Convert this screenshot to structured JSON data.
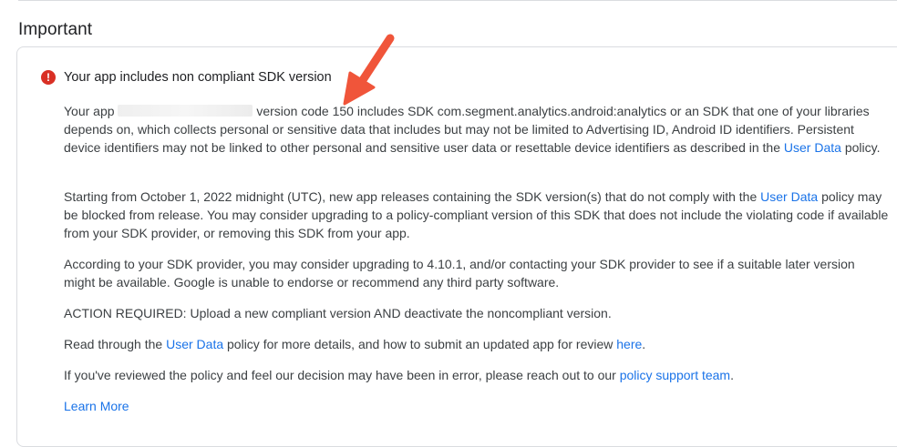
{
  "section": {
    "title": "Important"
  },
  "alert": {
    "icon": "error-icon",
    "icon_glyph": "!",
    "title": "Your app includes non compliant SDK version"
  },
  "paragraph1": {
    "prefix": "Your app",
    "suffix_part1": "version code 150 includes SDK com.segment.analytics.android:analytics or an SDK that one of your libraries depends on, which collects personal or sensitive data that includes but may not be limited to Advertising ID, Android ID identifiers. Persistent device identifiers may not be linked to other personal and sensitive user data or resettable device identifiers as described in the",
    "link": "User Data",
    "suffix_part2": "policy."
  },
  "paragraph2": {
    "text_before": "Starting from October 1, 2022 midnight (UTC), new app releases containing the SDK version(s) that do not comply with the",
    "link": "User Data",
    "text_after": "policy may be blocked from release. You may consider upgrading to a policy-compliant version of this SDK that does not include the violating code if available from your SDK provider, or removing this SDK from your app."
  },
  "paragraph3": {
    "text": "According to your SDK provider, you may consider upgrading to 4.10.1, and/or contacting your SDK provider to see if a suitable later version might be available. Google is unable to endorse or recommend any third party software."
  },
  "paragraph4": {
    "text": "ACTION REQUIRED: Upload a new compliant version AND deactivate the noncompliant version."
  },
  "paragraph5": {
    "text_before": "Read through the",
    "link1": "User Data",
    "text_middle": "policy for more details, and how to submit an updated app for review",
    "link2": "here",
    "text_after": "."
  },
  "paragraph6": {
    "text_before": "If you've reviewed the policy and feel our decision may have been in error, please reach out to our",
    "link": "policy support team",
    "text_after": "."
  },
  "learn_more": {
    "label": "Learn More"
  },
  "colors": {
    "link": "#1a73e8",
    "error": "#d93025",
    "annotation_arrow": "#f0553a"
  },
  "annotation": {
    "icon": "red-arrow-icon"
  }
}
